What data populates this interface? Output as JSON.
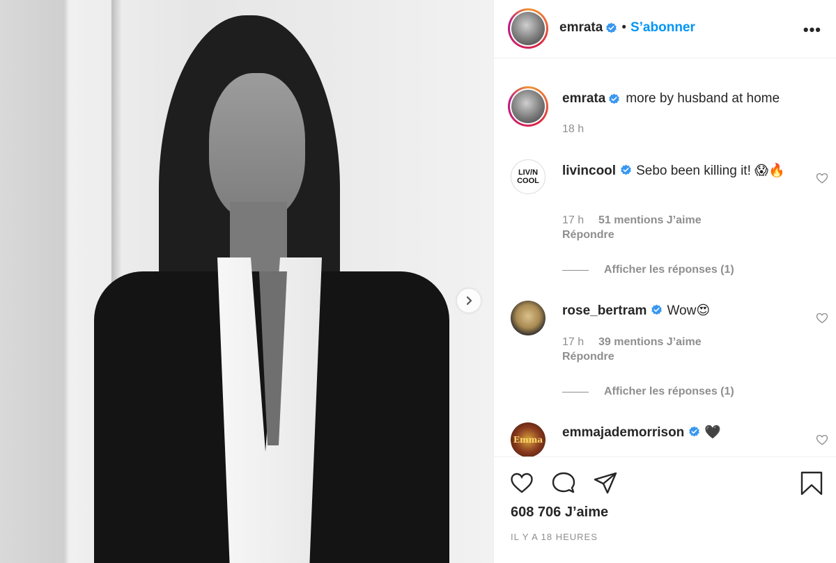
{
  "post": {
    "author": "emrata",
    "follow_label": "S’abonner",
    "separator": "•",
    "more_label": "•••",
    "caption": "more by husband at home",
    "caption_time": "18 h",
    "likes": "608 706 J’aime",
    "posted_ago": "IL Y A 18 HEURES"
  },
  "comments": [
    {
      "username": "livincool",
      "text": "Sebo been killing it! 😱🔥",
      "avatar_text": "LIV/N COOL",
      "time": "17 h",
      "likes": "51 mentions J’aime",
      "reply_label": "Répondre",
      "view_replies": "Afficher les réponses (1)"
    },
    {
      "username": "rose_bertram",
      "text": "Wow😍",
      "time": "17 h",
      "likes": "39 mentions J’aime",
      "reply_label": "Répondre",
      "view_replies": "Afficher les réponses (1)"
    },
    {
      "username": "emmajademorrison",
      "text": "🖤",
      "avatar_text": "Emma"
    }
  ],
  "colors": {
    "link": "#0095f6",
    "text": "#262626",
    "muted": "#8e8e8e",
    "verified": "#3897f0"
  },
  "icons": [
    "chevron-right-icon",
    "verified-icon",
    "more-icon",
    "heart-icon",
    "comment-icon",
    "share-icon",
    "bookmark-icon"
  ]
}
